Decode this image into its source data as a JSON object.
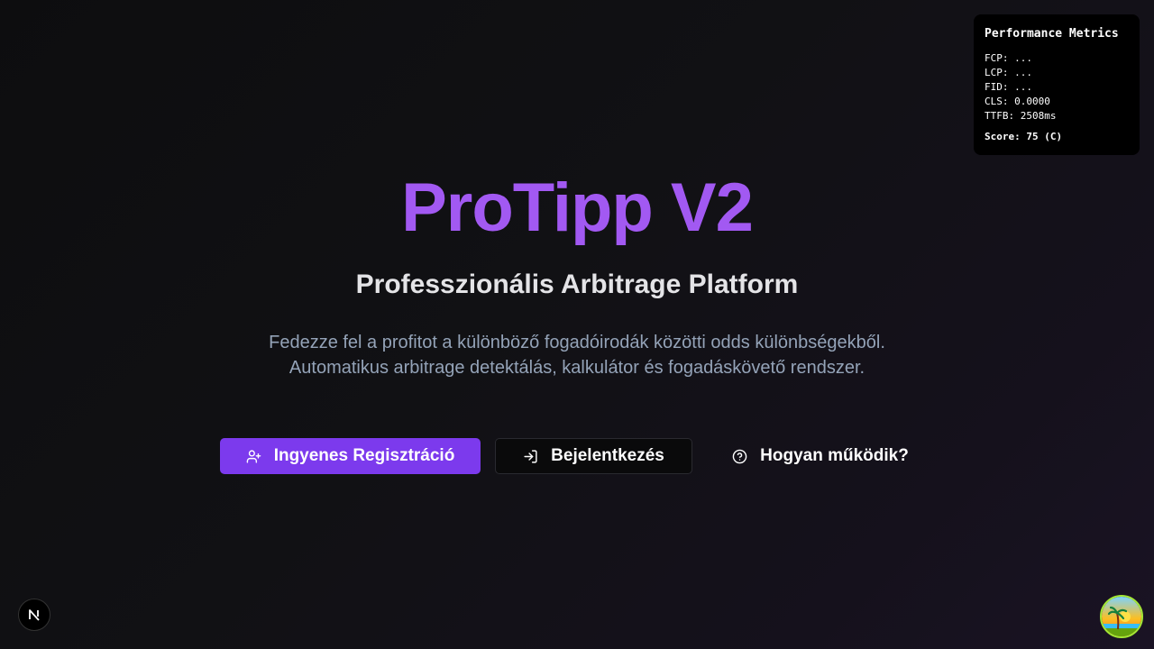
{
  "hero": {
    "title": "ProTipp V2",
    "subtitle": "Professzionális Arbitrage Platform",
    "description_line1": "Fedezze fel a profitot a különböző fogadóirodák közötti odds különbségekből.",
    "description_line2": "Automatikus arbitrage detektálás, kalkulátor és fogadáskövető rendszer."
  },
  "buttons": {
    "register": {
      "label": "Ingyenes Regisztráció",
      "icon": "user-plus-icon"
    },
    "login": {
      "label": "Bejelentkezés",
      "icon": "log-in-icon"
    },
    "how_it_works": {
      "label": "Hogyan működik?",
      "icon": "help-circle-icon"
    }
  },
  "performance": {
    "title": "Performance Metrics",
    "fcp": "FCP: ...",
    "lcp": "LCP: ...",
    "fid": "FID: ...",
    "cls": "CLS: 0.0000",
    "ttfb": "TTFB: 2508ms",
    "score": "Score: 75 (C)"
  },
  "colors": {
    "accent": "#7c3aed",
    "title": "#a259f2",
    "background": "#0d0d0f"
  }
}
